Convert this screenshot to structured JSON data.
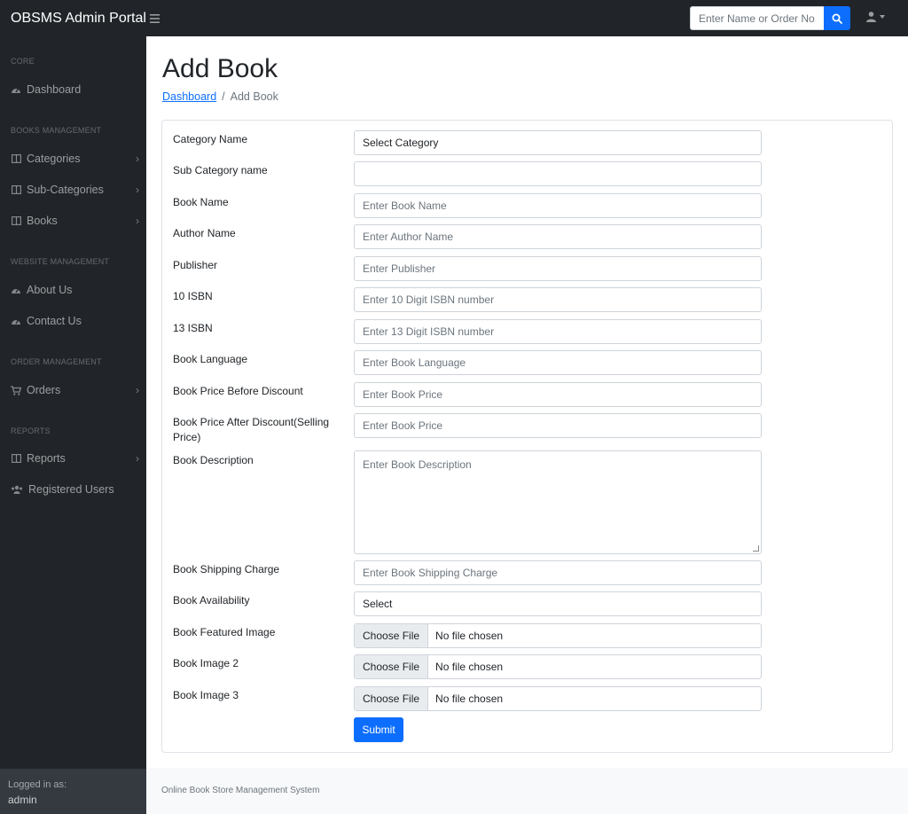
{
  "topbar": {
    "brand": "OBSMS Admin Portal",
    "search_placeholder": "Enter Name or Order No.",
    "toggle_icon": "hamburger-icon",
    "search_icon": "search-icon",
    "user_icon": "user-icon"
  },
  "sidebar": {
    "headings": {
      "core": "CORE",
      "books": "BOOKS MANAGEMENT",
      "website": "WEBSITE MANAGEMENT",
      "order": "ORDER MANAGEMENT",
      "reports": "REPORTS"
    },
    "items": {
      "dashboard": "Dashboard",
      "categories": "Categories",
      "subcategories": "Sub-Categories",
      "books": "Books",
      "about": "About Us",
      "contact": "Contact Us",
      "orders": "Orders",
      "reports": "Reports",
      "users": "Registered Users"
    },
    "footer": {
      "label": "Logged in as:",
      "user": "admin"
    }
  },
  "main": {
    "title": "Add Book",
    "breadcrumb": {
      "link": "Dashboard",
      "separator": "/",
      "current": "Add Book"
    },
    "form": {
      "category": {
        "label": "Category Name",
        "value": "Select Category"
      },
      "subcategory": {
        "label": "Sub Category name",
        "value": ""
      },
      "book_name": {
        "label": "Book Name",
        "placeholder": "Enter Book Name"
      },
      "author": {
        "label": "Author Name",
        "placeholder": "Enter Author Name"
      },
      "publisher": {
        "label": "Publisher",
        "placeholder": "Enter Publisher"
      },
      "isbn10": {
        "label": "10 ISBN",
        "placeholder": "Enter 10 Digit ISBN number"
      },
      "isbn13": {
        "label": "13 ISBN",
        "placeholder": "Enter 13 Digit ISBN number"
      },
      "language": {
        "label": "Book Language",
        "placeholder": "Enter Book Language"
      },
      "price_before": {
        "label": "Book Price Before Discount",
        "placeholder": "Enter Book Price"
      },
      "price_after": {
        "label": "Book Price After Discount(Selling Price)",
        "placeholder": "Enter Book Price"
      },
      "description": {
        "label": "Book Description",
        "placeholder": "Enter Book Description"
      },
      "shipping": {
        "label": "Book Shipping Charge",
        "placeholder": "Enter Book Shipping Charge"
      },
      "availability": {
        "label": "Book Availability",
        "value": "Select"
      },
      "featured_image": {
        "label": "Book Featured Image",
        "button": "Choose File",
        "status": "No file chosen"
      },
      "image2": {
        "label": "Book Image 2",
        "button": "Choose File",
        "status": "No file chosen"
      },
      "image3": {
        "label": "Book Image 3",
        "button": "Choose File",
        "status": "No file chosen"
      },
      "submit": "Submit"
    },
    "footer": "Online Book Store Management System"
  },
  "colors": {
    "nav_bg": "#212529",
    "primary": "#0d6efd",
    "footer_bg": "#f8f9fa"
  }
}
